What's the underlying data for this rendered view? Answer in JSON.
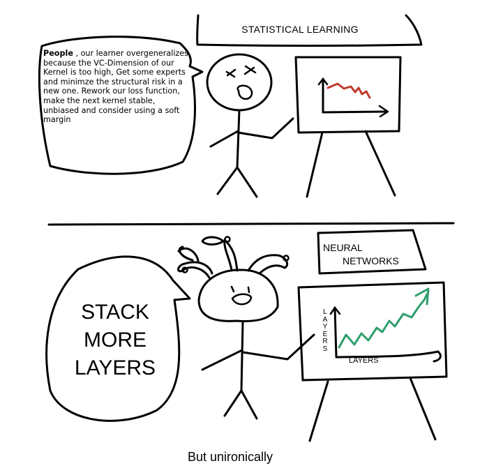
{
  "top_panel": {
    "sign": "STATISTICAL LEARNING",
    "speech_lead": "People",
    "speech_body": " , our learner overgeneralizes because the VC-Dimension of our Kernel is too high, Get some experts and minimze the structural risk in a new one. Rework our loss function, make the next kernel stable, unbiased and consider using a soft margin",
    "chart_color": "#c0392b"
  },
  "bottom_panel": {
    "sign_line1": "NEURAL",
    "sign_line2": "NETWORKS",
    "speech_line1": "STACK",
    "speech_line2": "MORE",
    "speech_line3": "LAYERS",
    "y_axis_label": "LAYERS",
    "x_axis_label": "LAYERS",
    "chart_color": "#2e9e6b"
  },
  "caption": "But unironically"
}
